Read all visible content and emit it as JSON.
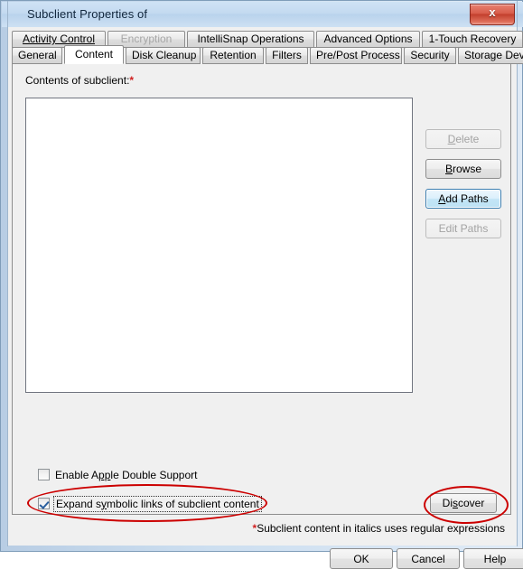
{
  "window": {
    "title": "Subclient Properties of",
    "close_icon": "close-icon",
    "close_glyph": "x"
  },
  "tabs": {
    "top_row": [
      {
        "label": "Activity Control",
        "mnemonic_text": "Activity Control",
        "state": "enabled"
      },
      {
        "label": "Encryption",
        "state": "disabled"
      },
      {
        "label": "IntelliSnap Operations",
        "state": "enabled"
      },
      {
        "label": "Advanced Options",
        "state": "enabled"
      },
      {
        "label": "1-Touch Recovery",
        "state": "enabled"
      }
    ],
    "bottom_row": [
      {
        "label": "General",
        "state": "enabled"
      },
      {
        "label": "Content",
        "state": "selected"
      },
      {
        "label": "Disk Cleanup",
        "state": "enabled"
      },
      {
        "label": "Retention",
        "state": "enabled"
      },
      {
        "label": "Filters",
        "state": "enabled"
      },
      {
        "label": "Pre/Post Process",
        "state": "enabled"
      },
      {
        "label": "Security",
        "state": "enabled"
      },
      {
        "label": "Storage Device",
        "state": "enabled"
      }
    ]
  },
  "content_tab": {
    "contents_label": "Contents of subclient:",
    "required_marker": "*",
    "listbox_items": [],
    "buttons": [
      {
        "id": "delete",
        "label": "Delete",
        "mnemonic": "D",
        "before": "",
        "after": "elete",
        "state": "disabled"
      },
      {
        "id": "browse",
        "label": "Browse",
        "mnemonic": "B",
        "before": "",
        "after": "rowse",
        "state": "enabled"
      },
      {
        "id": "add_paths",
        "label": "Add Paths",
        "mnemonic": "A",
        "before": "",
        "after": "dd Paths",
        "state": "focused"
      },
      {
        "id": "edit_paths",
        "label": "Edit Paths",
        "mnemonic": "",
        "before": "Edit Paths",
        "after": "",
        "state": "disabled"
      }
    ],
    "checkboxes": [
      {
        "id": "enable_apple_double",
        "label": "Enable Apple Double Support",
        "before": "Enable A",
        "mnemonic": "pp",
        "after": "le Double Support",
        "checked": false,
        "focused": false
      },
      {
        "id": "expand_symbolic_links",
        "label": "Expand symbolic links of subclient content",
        "before": "Expand s",
        "mnemonic": "y",
        "after": "mbolic links of subclient content",
        "checked": true,
        "focused": true
      }
    ],
    "discover_button": {
      "label": "Discover",
      "before": "Di",
      "mnemonic": "s",
      "after": "cover"
    },
    "footnote": {
      "marker": "*",
      "text": "Subclient content in italics uses regular expressions"
    }
  },
  "dialog_buttons": [
    {
      "id": "ok",
      "label": "OK"
    },
    {
      "id": "cancel",
      "label": "Cancel"
    },
    {
      "id": "help",
      "label": "Help"
    }
  ],
  "annotations": [
    {
      "id": "highlight-expand-symlinks",
      "shape": "ellipse",
      "color": "#cc0000"
    },
    {
      "id": "highlight-discover-button",
      "shape": "ellipse",
      "color": "#cc0000"
    }
  ]
}
